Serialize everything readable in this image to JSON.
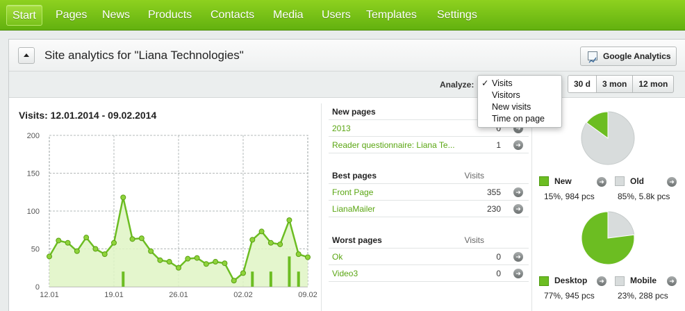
{
  "nav": {
    "items": [
      "Start",
      "Pages",
      "News",
      "Products",
      "Contacts",
      "Media",
      "Users",
      "Templates",
      "Settings"
    ],
    "active": "Start"
  },
  "panel": {
    "title": "Site analytics for \"Liana Technologies\"",
    "google_analytics_label": "Google Analytics"
  },
  "toolbar": {
    "analyze_label": "Analyze:",
    "analyze_options": [
      "Visits",
      "Visitors",
      "New visits",
      "Time on page"
    ],
    "analyze_selected": "Visits",
    "range_buttons": [
      "30 d",
      "3 mon",
      "12 mon"
    ],
    "range_selected": "30 d"
  },
  "chart_data": {
    "type": "line",
    "title": "Visits: 12.01.2014 - 09.02.2014",
    "ylim": [
      0,
      200
    ],
    "yticks": [
      0,
      50,
      100,
      150,
      200
    ],
    "xtick_labels": [
      "12.01",
      "19.01",
      "26.01",
      "02.02",
      "09.02"
    ],
    "x": [
      "12.01",
      "13.01",
      "14.01",
      "15.01",
      "16.01",
      "17.01",
      "18.01",
      "19.01",
      "20.01",
      "21.01",
      "22.01",
      "23.01",
      "24.01",
      "25.01",
      "26.01",
      "27.01",
      "28.01",
      "29.01",
      "30.01",
      "31.01",
      "01.02",
      "02.02",
      "03.02",
      "04.02",
      "05.02",
      "06.02",
      "07.02",
      "08.02",
      "09.02"
    ],
    "series": [
      {
        "values": [
          40,
          61,
          58,
          47,
          65,
          50,
          43,
          58,
          118,
          63,
          64,
          47,
          35,
          33,
          25,
          37,
          38,
          30,
          33,
          31,
          8,
          18,
          62,
          73,
          58,
          56,
          88,
          43,
          39
        ]
      }
    ],
    "bars": [
      {
        "x": "20.01",
        "value": 20
      },
      {
        "x": "03.02",
        "value": 20
      },
      {
        "x": "05.02",
        "value": 20
      },
      {
        "x": "07.02",
        "value": 40
      },
      {
        "x": "08.02",
        "value": 20
      }
    ],
    "grid": true,
    "colors": {
      "line": "#6cbd22",
      "fill": "#dff4c4",
      "point": "#8fd33c",
      "bar": "#6cbd22"
    }
  },
  "new_pages": {
    "heading": "New pages",
    "rows": [
      {
        "name": "2013",
        "value": "0"
      },
      {
        "name": "Reader questionnaire: Liana Te...",
        "value": "1"
      }
    ]
  },
  "best_pages": {
    "heading": "Best pages",
    "value_heading": "Visits",
    "rows": [
      {
        "name": "Front Page",
        "value": "355"
      },
      {
        "name": "LianaMailer",
        "value": "230"
      }
    ]
  },
  "worst_pages": {
    "heading": "Worst pages",
    "value_heading": "Visits",
    "rows": [
      {
        "name": "Ok",
        "value": "0"
      },
      {
        "name": "Video3",
        "value": "0"
      }
    ]
  },
  "visitor_pie": {
    "new": {
      "label": "New",
      "value": "15%, 984 pcs",
      "fraction": 0.15
    },
    "old": {
      "label": "Old",
      "value": "85%, 5.8k pcs",
      "fraction": 0.85
    }
  },
  "device_pie": {
    "desktop": {
      "label": "Desktop",
      "value": "77%, 945 pcs",
      "fraction": 0.77
    },
    "mobile": {
      "label": "Mobile",
      "value": "23%, 288 pcs",
      "fraction": 0.23
    }
  },
  "colors": {
    "green": "#6cbd22",
    "grey": "#d8dcdc",
    "link": "#5aa612"
  }
}
